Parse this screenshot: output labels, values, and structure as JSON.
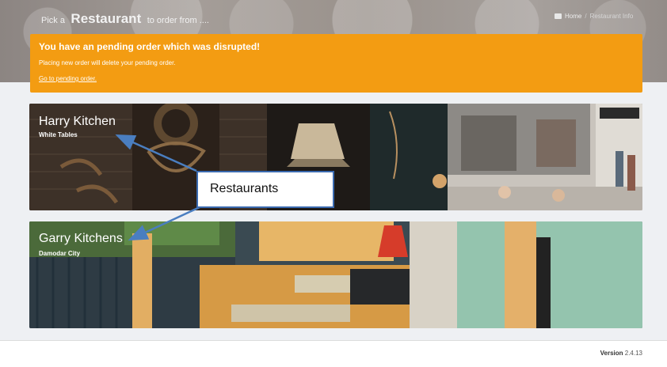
{
  "header": {
    "title_prefix": "Pick a",
    "title_main": "Restaurant",
    "title_suffix": "to order from ....",
    "breadcrumb": {
      "home": "Home",
      "current": "Restaurant Info"
    }
  },
  "alert": {
    "title": "You have an pending order which was disrupted!",
    "message": "Placing new order will delete your pending order.",
    "link": "Go to pending order.",
    "color": "#f39c12"
  },
  "restaurants": [
    {
      "name": "Harry Kitchen",
      "location": "White Tables"
    },
    {
      "name": "Garry Kitchens",
      "location": "Damodar City"
    }
  ],
  "annotation": {
    "label": "Restaurants",
    "color": "#4a7ec0"
  },
  "footer": {
    "version_label": "Version",
    "version_number": "2.4.13"
  }
}
